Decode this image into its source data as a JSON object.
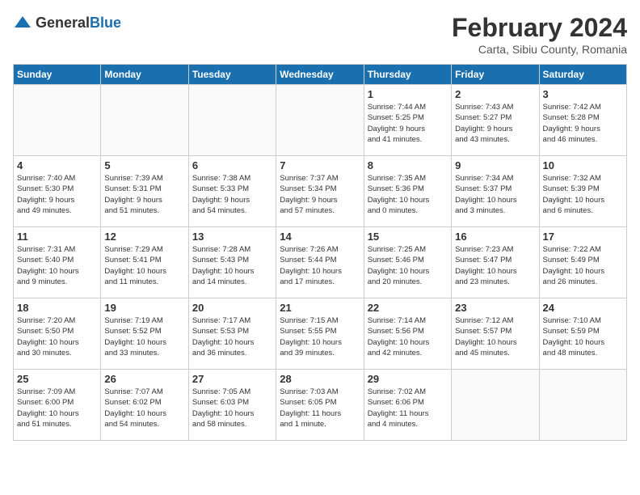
{
  "logo": {
    "text_general": "General",
    "text_blue": "Blue"
  },
  "title": "February 2024",
  "subtitle": "Carta, Sibiu County, Romania",
  "headers": [
    "Sunday",
    "Monday",
    "Tuesday",
    "Wednesday",
    "Thursday",
    "Friday",
    "Saturday"
  ],
  "weeks": [
    [
      {
        "day": "",
        "info": ""
      },
      {
        "day": "",
        "info": ""
      },
      {
        "day": "",
        "info": ""
      },
      {
        "day": "",
        "info": ""
      },
      {
        "day": "1",
        "info": "Sunrise: 7:44 AM\nSunset: 5:25 PM\nDaylight: 9 hours\nand 41 minutes."
      },
      {
        "day": "2",
        "info": "Sunrise: 7:43 AM\nSunset: 5:27 PM\nDaylight: 9 hours\nand 43 minutes."
      },
      {
        "day": "3",
        "info": "Sunrise: 7:42 AM\nSunset: 5:28 PM\nDaylight: 9 hours\nand 46 minutes."
      }
    ],
    [
      {
        "day": "4",
        "info": "Sunrise: 7:40 AM\nSunset: 5:30 PM\nDaylight: 9 hours\nand 49 minutes."
      },
      {
        "day": "5",
        "info": "Sunrise: 7:39 AM\nSunset: 5:31 PM\nDaylight: 9 hours\nand 51 minutes."
      },
      {
        "day": "6",
        "info": "Sunrise: 7:38 AM\nSunset: 5:33 PM\nDaylight: 9 hours\nand 54 minutes."
      },
      {
        "day": "7",
        "info": "Sunrise: 7:37 AM\nSunset: 5:34 PM\nDaylight: 9 hours\nand 57 minutes."
      },
      {
        "day": "8",
        "info": "Sunrise: 7:35 AM\nSunset: 5:36 PM\nDaylight: 10 hours\nand 0 minutes."
      },
      {
        "day": "9",
        "info": "Sunrise: 7:34 AM\nSunset: 5:37 PM\nDaylight: 10 hours\nand 3 minutes."
      },
      {
        "day": "10",
        "info": "Sunrise: 7:32 AM\nSunset: 5:39 PM\nDaylight: 10 hours\nand 6 minutes."
      }
    ],
    [
      {
        "day": "11",
        "info": "Sunrise: 7:31 AM\nSunset: 5:40 PM\nDaylight: 10 hours\nand 9 minutes."
      },
      {
        "day": "12",
        "info": "Sunrise: 7:29 AM\nSunset: 5:41 PM\nDaylight: 10 hours\nand 11 minutes."
      },
      {
        "day": "13",
        "info": "Sunrise: 7:28 AM\nSunset: 5:43 PM\nDaylight: 10 hours\nand 14 minutes."
      },
      {
        "day": "14",
        "info": "Sunrise: 7:26 AM\nSunset: 5:44 PM\nDaylight: 10 hours\nand 17 minutes."
      },
      {
        "day": "15",
        "info": "Sunrise: 7:25 AM\nSunset: 5:46 PM\nDaylight: 10 hours\nand 20 minutes."
      },
      {
        "day": "16",
        "info": "Sunrise: 7:23 AM\nSunset: 5:47 PM\nDaylight: 10 hours\nand 23 minutes."
      },
      {
        "day": "17",
        "info": "Sunrise: 7:22 AM\nSunset: 5:49 PM\nDaylight: 10 hours\nand 26 minutes."
      }
    ],
    [
      {
        "day": "18",
        "info": "Sunrise: 7:20 AM\nSunset: 5:50 PM\nDaylight: 10 hours\nand 30 minutes."
      },
      {
        "day": "19",
        "info": "Sunrise: 7:19 AM\nSunset: 5:52 PM\nDaylight: 10 hours\nand 33 minutes."
      },
      {
        "day": "20",
        "info": "Sunrise: 7:17 AM\nSunset: 5:53 PM\nDaylight: 10 hours\nand 36 minutes."
      },
      {
        "day": "21",
        "info": "Sunrise: 7:15 AM\nSunset: 5:55 PM\nDaylight: 10 hours\nand 39 minutes."
      },
      {
        "day": "22",
        "info": "Sunrise: 7:14 AM\nSunset: 5:56 PM\nDaylight: 10 hours\nand 42 minutes."
      },
      {
        "day": "23",
        "info": "Sunrise: 7:12 AM\nSunset: 5:57 PM\nDaylight: 10 hours\nand 45 minutes."
      },
      {
        "day": "24",
        "info": "Sunrise: 7:10 AM\nSunset: 5:59 PM\nDaylight: 10 hours\nand 48 minutes."
      }
    ],
    [
      {
        "day": "25",
        "info": "Sunrise: 7:09 AM\nSunset: 6:00 PM\nDaylight: 10 hours\nand 51 minutes."
      },
      {
        "day": "26",
        "info": "Sunrise: 7:07 AM\nSunset: 6:02 PM\nDaylight: 10 hours\nand 54 minutes."
      },
      {
        "day": "27",
        "info": "Sunrise: 7:05 AM\nSunset: 6:03 PM\nDaylight: 10 hours\nand 58 minutes."
      },
      {
        "day": "28",
        "info": "Sunrise: 7:03 AM\nSunset: 6:05 PM\nDaylight: 11 hours\nand 1 minute."
      },
      {
        "day": "29",
        "info": "Sunrise: 7:02 AM\nSunset: 6:06 PM\nDaylight: 11 hours\nand 4 minutes."
      },
      {
        "day": "",
        "info": ""
      },
      {
        "day": "",
        "info": ""
      }
    ]
  ]
}
